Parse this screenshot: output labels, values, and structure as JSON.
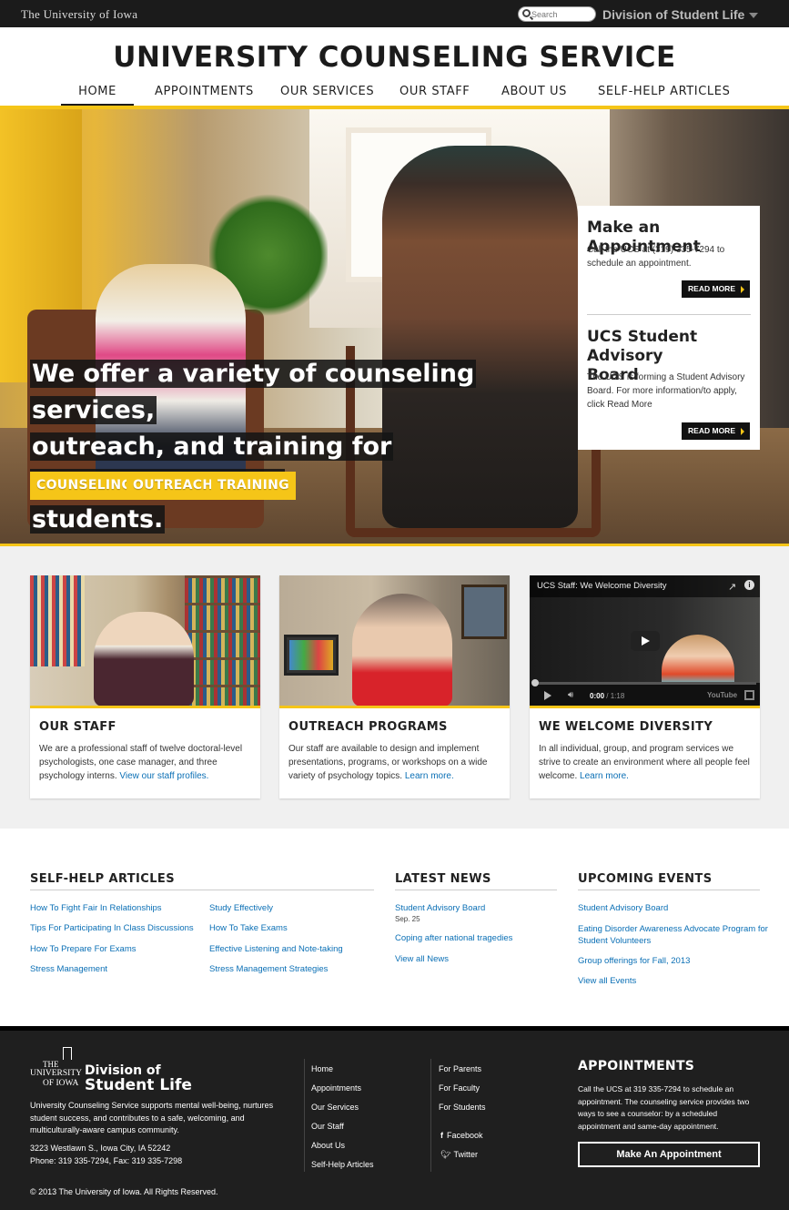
{
  "topbar": {
    "university": "The University of Iowa",
    "search_placeholder": "Search",
    "division": "Division of Student Life"
  },
  "header": {
    "title": "UNIVERSITY COUNSELING SERVICE"
  },
  "nav": [
    {
      "label": "HOME",
      "active": true
    },
    {
      "label": "APPOINTMENTS"
    },
    {
      "label": "OUR SERVICES"
    },
    {
      "label": "OUR STAFF"
    },
    {
      "label": "ABOUT US"
    },
    {
      "label": "SELF-HELP ARTICLES"
    }
  ],
  "hero": {
    "headline_1": "We offer a variety of counseling services,",
    "headline_2": "outreach, and training for University of Iowa",
    "headline_3": "students.",
    "buttons": [
      "COUNSELING",
      "OUTREACH",
      "TRAINING"
    ],
    "panel": {
      "appt_title": "Make an Appointment",
      "appt_text": "Call the UCS at (319) 335-7294 to schedule an appointment.",
      "appt_more": "READ MORE",
      "board_title_1": "UCS Student Advisory",
      "board_title_2": "Board",
      "board_text": "The UCS is forming a Student Advisory Board. For more information/to apply, click Read More",
      "board_more": "READ MORE"
    }
  },
  "cards": {
    "staff": {
      "title": "OUR STAFF",
      "text": "We are a professional staff of twelve doctoral-level psychologists, one case manager, and three psychology interns.",
      "link": "View our staff profiles."
    },
    "outreach": {
      "title": "OUTREACH PROGRAMS",
      "text": "Our staff are available to design and implement presentations, programs, or workshops on a wide variety of psychology topics.",
      "link": "Learn more."
    },
    "diversity": {
      "title": "WE WELCOME DIVERSITY",
      "text": "In all individual, group, and program services we strive to create an environment where all people feel welcome.",
      "link": "Learn more.",
      "video_title": "UCS Staff: We Welcome Diversity",
      "video_time": "0:00",
      "video_duration": "/ 1:18",
      "video_brand": "YouTube"
    }
  },
  "self_help": {
    "title": "SELF-HELP ARTICLES",
    "col1": [
      "How To Fight Fair In Relationships",
      "Tips For Participating In Class Discussions",
      "How To Prepare For Exams",
      "Stress Management"
    ],
    "col2": [
      "Study Effectively",
      "How To Take Exams",
      "Effective Listening and Note-taking",
      "Stress Management Strategies"
    ]
  },
  "news": {
    "title": "LATEST NEWS",
    "item1": "Student Advisory Board",
    "item1_date": "Sep. 25",
    "item2": "Coping after national tragedies",
    "all": "View all News"
  },
  "events": {
    "title": "UPCOMING EVENTS",
    "item1": "Student Advisory Board",
    "item2_1": "Eating Disorder Awareness Advocate Program for",
    "item2_2": "Student Volunteers",
    "item3": "Group offerings for Fall, 2013",
    "all": "View all Events"
  },
  "footer": {
    "logo_the": "THE",
    "logo_university": "UNIVERSITY",
    "logo_of_iowa": "OF IOWA",
    "logo_division": "Division of",
    "logo_student_life": "Student Life",
    "mission": "University Counseling Service supports mental well-being, nurtures student success, and contributes to a safe, welcoming, and multiculturally-aware campus community.",
    "address": "3223 Westlawn S., Iowa City, IA 52242",
    "phone": "Phone: 319 335-7294, Fax: 319 335-7298",
    "links1": [
      "Home",
      "Appointments",
      "Our Services",
      "Our Staff",
      "About Us",
      "Self-Help Articles"
    ],
    "links2": [
      "For Parents",
      "For Faculty",
      "For Students"
    ],
    "facebook": "Facebook",
    "twitter": "Twitter",
    "appt_title": "APPOINTMENTS",
    "appt_text": "Call the UCS at 319 335-7294 to schedule an appointment. The counseling service provides two ways to see a counselor: by a scheduled appointment and same-day appointment.",
    "appt_button": "Make An Appointment",
    "copyright": "© 2013 The University of Iowa. All Rights Reserved."
  },
  "colors": {
    "gold": "#f5c518",
    "dark": "#1f1f1f",
    "link": "#0a6fb5"
  }
}
